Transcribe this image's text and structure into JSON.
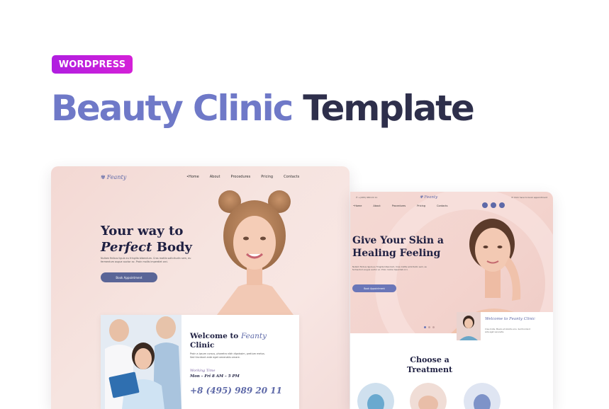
{
  "badge": "WORDPRESS",
  "headline": {
    "accent": "Beauty Clinic",
    "rest": "Template"
  },
  "left_mockup": {
    "logo": "Feanty",
    "nav": [
      "•Home",
      "About",
      "Procedures",
      "Pricing",
      "Contacts"
    ],
    "hero_title_line1": "Your way to",
    "hero_title_italic": "Perfect",
    "hero_title_rest": " Body",
    "hero_text": "Nullam finibus ligula eu fringilla bibendum. Cras mattis sollicitudin sem, eu fermentum augue auctor ac. Proin mollis imperdiet orci.",
    "button": "Book Appointment",
    "card": {
      "title_pre": "Welcome to ",
      "title_italic": "Feanty",
      "title_post": "Clinic",
      "text": "Proin a ipsum cursus, pharetra nibh dignissim, pretium metus. Sed tincidunt ante eget venenatis ornare.",
      "hours_label": "Working Time",
      "hours": "Mon – Fri 8 AM – 5 PM",
      "phone": "+8 (495) 989 20 11"
    }
  },
  "right_mockup": {
    "topbar_left": "✆ +(495) 989 20 11",
    "topbar_right": "✉ Click here to book appointment",
    "logo": "Feanty",
    "nav": [
      "•Home",
      "About",
      "Procedures",
      "Pricing",
      "Contacts"
    ],
    "hero_title": "Give Your Skin a Healing Feeling",
    "hero_text": "Nullam finibus ligula eu fringilla bibendum. Cras mattis sollicitudin sem, eu fermentum augue auctor ac. Proin mollis imperdiet orci.",
    "button": "Book Appointment",
    "welcome_title": "Welcome to Feanty Clinic",
    "welcome_text": "Cras mollis. Mauris et lobortis arcu. Sed tincidunt ante eget venenatis.",
    "section_title": "Choose a Treatment"
  },
  "colors": {
    "badge": "#c21fdc",
    "accent": "#6f79c8",
    "dark": "#2e2f4b",
    "button": "#5a6597"
  }
}
